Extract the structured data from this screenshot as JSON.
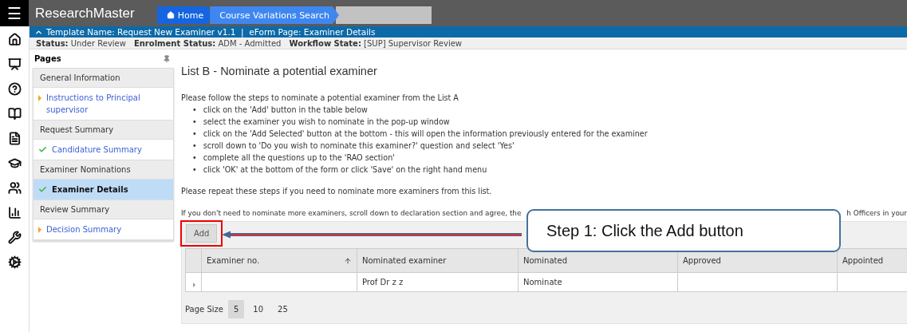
{
  "app": {
    "menu_icon": "☰",
    "title": "ResearchMaster"
  },
  "breadcrumb": [
    {
      "label": "Home",
      "kind": "home"
    },
    {
      "label": "Course Variations Search",
      "kind": "page"
    },
    {
      "kind": "blank"
    }
  ],
  "template_bar": {
    "text": "Template Name: Request New Examiner v1.1  |  eForm Page: Examiner Details"
  },
  "status_line": [
    {
      "label": "Status:",
      "value": "Under Review"
    },
    {
      "label": "Enrolment Status:",
      "value": "ADM - Admitted"
    },
    {
      "label": "Workflow State:",
      "value": "[SUP] Supervisor Review"
    }
  ],
  "sidebar": {
    "title": "Pages",
    "sections": [
      {
        "heading": "General Information",
        "items": [
          {
            "label": "Instructions to Principal supervisor",
            "kind": "pending",
            "selected": false
          }
        ]
      },
      {
        "heading": "Request Summary",
        "items": [
          {
            "label": "Candidature Summary",
            "kind": "done",
            "selected": false
          }
        ]
      },
      {
        "heading": "Examiner Nominations",
        "items": [
          {
            "label": "Examiner Details",
            "kind": "done",
            "selected": true
          }
        ]
      },
      {
        "heading": "Review Summary",
        "items": [
          {
            "label": "Decision Summary",
            "kind": "pending",
            "selected": false
          }
        ]
      }
    ]
  },
  "content": {
    "heading": "List B - Nominate a potential examiner",
    "bullet": "•",
    "intro": "Please follow the steps to nominate a potential examiner from the List A",
    "steps": [
      "click on the 'Add' button in the table below",
      "select the examiner you wish to nominate in the pop-up window",
      "click on the 'Add Selected' button at the bottom - this will open the information previously entered for the examiner",
      "scroll down to 'Do you wish to nominate this examiner?' question and select 'Yes'",
      "complete all the questions up to the 'RAO section'",
      "click 'OK' at the bottom of the form or click 'Save' on the right hand menu"
    ],
    "repeat_note": "Please repeat these steps if you need to nominate more examiners from this list.",
    "note_start": "If you don't need to nominate more examiners, scroll down to declaration section and agree, the",
    "note_end": "h Officers in your",
    "add_button": "Add",
    "table": {
      "columns": [
        {
          "label": "Examiner no.",
          "sorted": true
        },
        {
          "label": "Nominated examiner",
          "sorted": false
        },
        {
          "label": "Nominated",
          "sorted": false
        },
        {
          "label": "Approved",
          "sorted": false
        },
        {
          "label": "Appointed",
          "sorted": false
        }
      ],
      "rows": [
        {
          "expanded": false,
          "cells": [
            "",
            "Prof Dr z z",
            "Nominate",
            "",
            ""
          ]
        }
      ]
    },
    "page_size": {
      "label": "Page Size",
      "options": [
        {
          "label": "5",
          "selected": true
        },
        {
          "label": "10",
          "selected": false
        },
        {
          "label": "25",
          "selected": false
        }
      ]
    },
    "callout": {
      "text": "Step 1: Click the Add button"
    }
  }
}
